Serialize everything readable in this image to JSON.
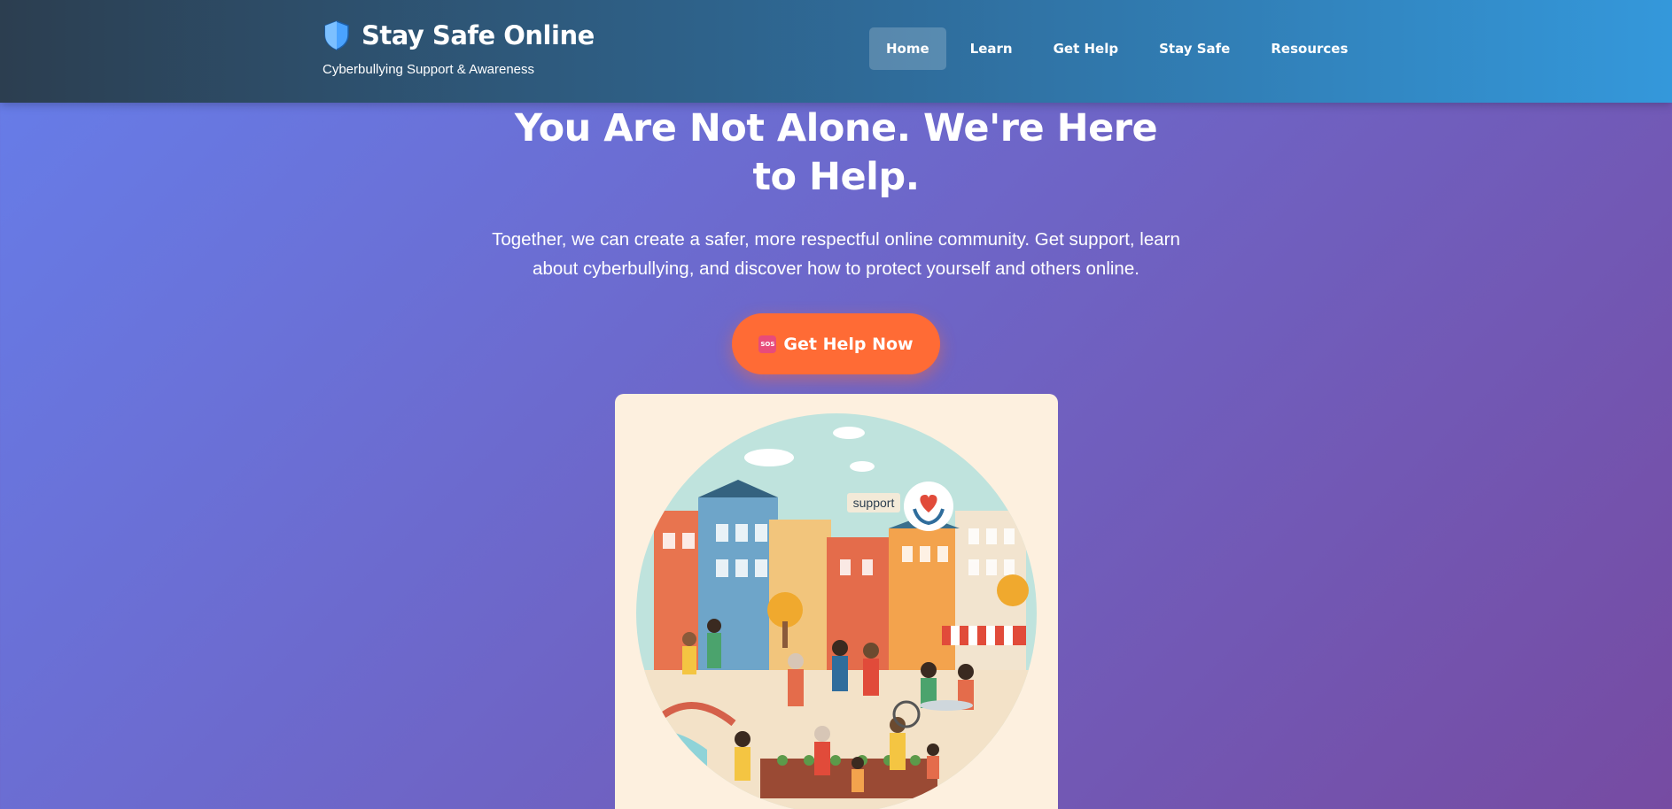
{
  "header": {
    "brand_icon": "shield-icon",
    "title": "Stay Safe Online",
    "tagline": "Cyberbullying Support & Awareness",
    "nav": [
      {
        "label": "Home",
        "active": true
      },
      {
        "label": "Learn",
        "active": false
      },
      {
        "label": "Get Help",
        "active": false
      },
      {
        "label": "Stay Safe",
        "active": false
      },
      {
        "label": "Resources",
        "active": false
      }
    ]
  },
  "hero": {
    "title": "You Are Not Alone. We're Here to Help.",
    "subtitle": "Together, we can create a safer, more respectful online community. Get support, learn about cyberbullying, and discover how to protect yourself and others online.",
    "cta_icon": "sos-icon",
    "cta_icon_text": "SOS",
    "cta_label": "Get Help Now"
  },
  "illustration": {
    "bubble_text": "support"
  },
  "colors": {
    "accent": "#ff6b35",
    "header_start": "#2c3e50",
    "header_end": "#3498db",
    "bg_start": "#667eea",
    "bg_end": "#764ba2"
  }
}
